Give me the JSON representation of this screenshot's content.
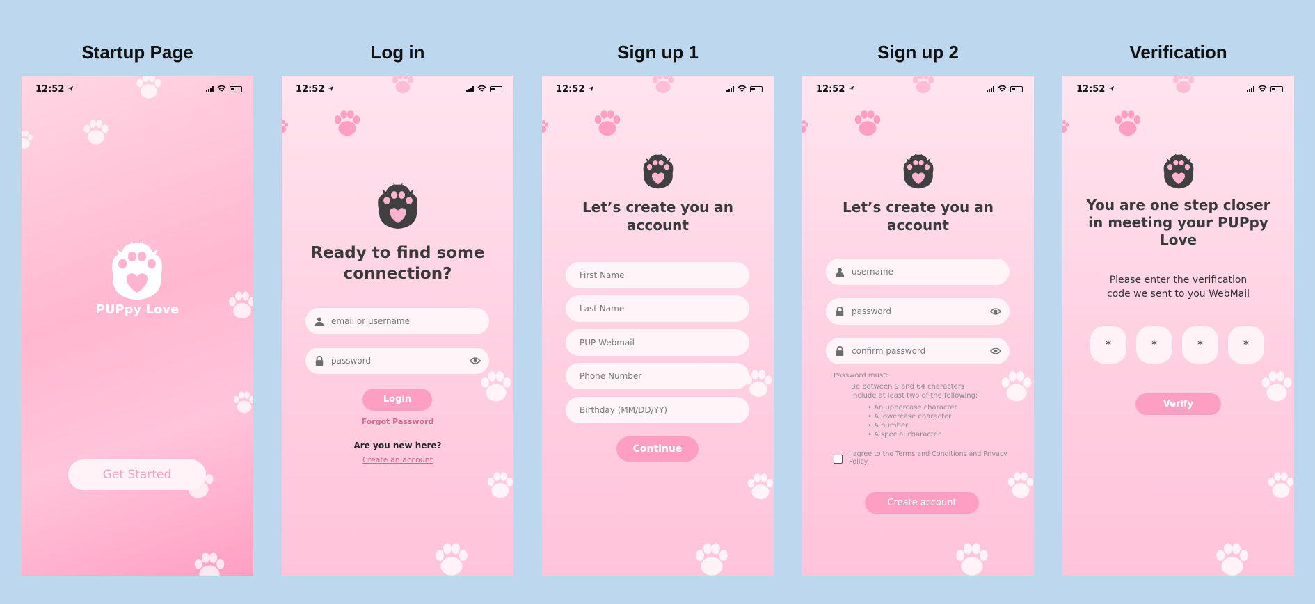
{
  "screens": {
    "startup": {
      "title": "Startup Page",
      "time": "12:52",
      "brand": "PUPpy Love",
      "get_started": "Get Started"
    },
    "login": {
      "title": "Log in",
      "time": "12:52",
      "headline_line1": "Ready to find some",
      "headline_line2": "connection?",
      "email_placeholder": "email or username",
      "password_placeholder": "password",
      "login_button": "Login",
      "forgot_password": "Forgot Password",
      "new_here": "Are you new here?",
      "create_account": "Create an account"
    },
    "signup1": {
      "title": "Sign up 1",
      "time": "12:52",
      "headline_line1": "Let’s create you an",
      "headline_line2": "account",
      "fields": [
        "First Name",
        "Last Name",
        "PUP Webmail",
        "Phone Number",
        "Birthday (MM/DD/YY)"
      ],
      "continue_button": "Continue"
    },
    "signup2": {
      "title": "Sign up 2",
      "time": "12:52",
      "headline_line1": "Let’s create you an",
      "headline_line2": "account",
      "username_placeholder": "username",
      "password_placeholder": "password",
      "confirm_placeholder": "confirm password",
      "rules_title": "Password must:",
      "rule1": "Be between 9 and 64 characters",
      "rule2": "Include at least two of the following:",
      "bullets": [
        "• An uppercase character",
        "• A lowercase character",
        "• A number",
        "• A special character"
      ],
      "terms_line1": "I agree to the Terms and Conditions and Privacy",
      "terms_line2": "Policy...",
      "create_button": "Create account"
    },
    "verification": {
      "title": "Verification",
      "time": "12:52",
      "headline_line1": "You are one step closer",
      "headline_line2": "in meeting your PUPpy",
      "headline_line3": "Love",
      "instruction_line1": "Please enter the verification",
      "instruction_line2": "code we sent to you WebMail",
      "code": [
        "*",
        "*",
        "*",
        "*"
      ],
      "verify_button": "Verify"
    }
  },
  "colors": {
    "background": "#bcd7ee",
    "accent_pink": "#ff9ec3",
    "paw_dark": "#404040",
    "paw_pink": "#ffb3cf"
  }
}
